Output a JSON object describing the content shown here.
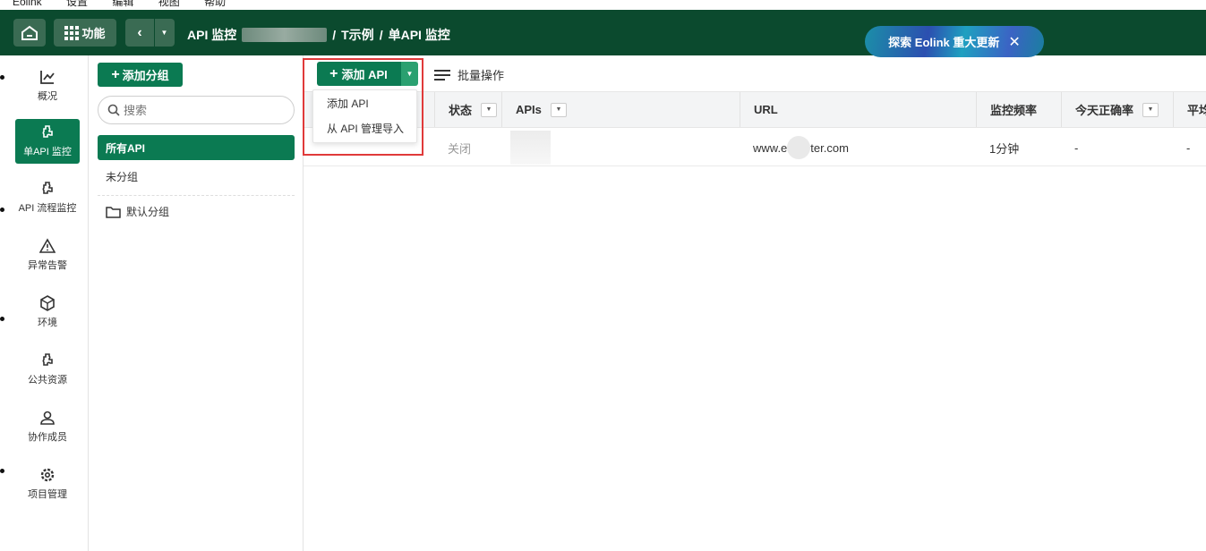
{
  "menubar": {
    "items": [
      "Eolink",
      "设置",
      "编辑",
      "视图",
      "帮助"
    ]
  },
  "topbar": {
    "func_label": "功能",
    "breadcrumb": {
      "root": "API 监控",
      "project": "T示例",
      "page": "单API 监控",
      "sep": "/"
    },
    "banner_text": "探索 Eolink 重大更新",
    "banner_close": "✕"
  },
  "nav": {
    "items": [
      {
        "label": "概况",
        "icon": "chart-icon"
      },
      {
        "label": "单API 监控",
        "icon": "puzzle-icon",
        "active": true
      },
      {
        "label": "API 流程监控",
        "icon": "puzzle-icon"
      },
      {
        "label": "异常告警",
        "icon": "warning-icon"
      },
      {
        "label": "环境",
        "icon": "cube-icon"
      },
      {
        "label": "公共资源",
        "icon": "puzzle-icon"
      },
      {
        "label": "协作成员",
        "icon": "user-icon"
      },
      {
        "label": "项目管理",
        "icon": "gear-icon"
      }
    ]
  },
  "groups": {
    "add_label": "添加分组",
    "search_placeholder": "搜索",
    "items": [
      "所有API",
      "未分组",
      "默认分组"
    ]
  },
  "toolbar": {
    "add_api_label": "添加 API",
    "batch_label": "批量操作",
    "dropdown": [
      "添加 API",
      "从 API 管理导入"
    ]
  },
  "table": {
    "columns": [
      "状态",
      "APIs",
      "URL",
      "监控频率",
      "今天正确率",
      "平均"
    ],
    "rows": [
      {
        "status": "关闭",
        "url_prefix": "www.e",
        "url_suffix": "ter.com",
        "frequency": "1分钟",
        "rate": "-",
        "avg": "-"
      }
    ]
  },
  "colors": {
    "brand_dark": "#0b4a2e",
    "brand": "#0b7a52",
    "highlight": "#e03a3a"
  }
}
